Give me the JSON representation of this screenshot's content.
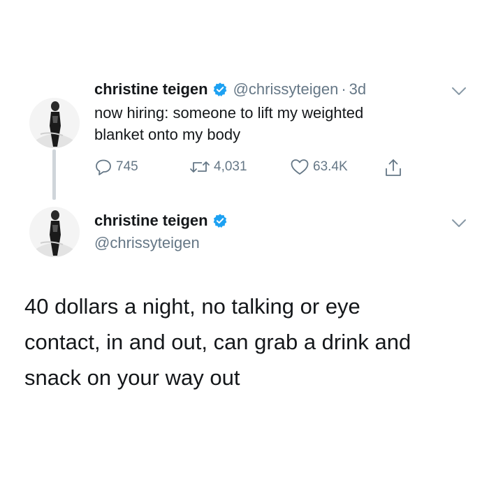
{
  "tweet1": {
    "author_name": "christine teigen",
    "handle": "@chrissyteigen",
    "separator": "·",
    "time": "3d",
    "text_line1": "now hiring: someone to lift my weighted",
    "text_line2": "blanket onto my body",
    "replies": "745",
    "retweets": "4,031",
    "likes": "63.4K",
    "avatar_icon": "profile-photo",
    "verified_icon": "verified-badge-icon",
    "menu_icon": "chevron-down-icon"
  },
  "tweet2": {
    "author_name": "christine teigen",
    "handle": "@chrissyteigen",
    "text_line1": "40 dollars a night, no talking or eye",
    "text_line2": "contact, in and out, can grab a drink and",
    "text_line3": "snack on your way out",
    "avatar_icon": "profile-photo",
    "verified_icon": "verified-badge-icon",
    "menu_icon": "chevron-down-icon"
  },
  "colors": {
    "text": "#14171a",
    "secondary": "#657786",
    "verified": "#1da1f2",
    "thread_line": "#cfd5da"
  }
}
